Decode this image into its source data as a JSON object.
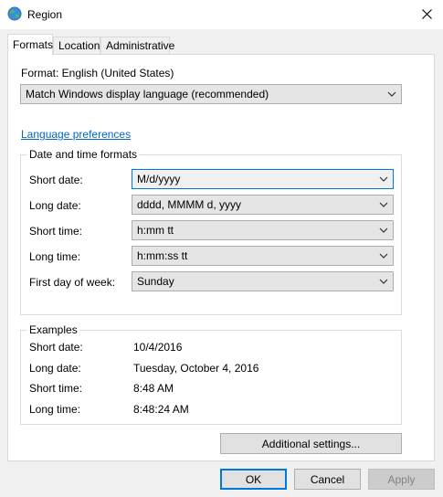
{
  "window": {
    "title": "Region",
    "close_icon": "close-icon",
    "app_icon": "globe-icon"
  },
  "tabs": [
    {
      "label": "Formats",
      "active": true
    },
    {
      "label": "Location",
      "active": false
    },
    {
      "label": "Administrative",
      "active": false
    }
  ],
  "format": {
    "label": "Format: English (United States)",
    "selected": "Match Windows display language (recommended)"
  },
  "language_link": "Language preferences",
  "date_time_group": {
    "title": "Date and time formats",
    "rows": [
      {
        "label": "Short date:",
        "value": "M/d/yyyy"
      },
      {
        "label": "Long date:",
        "value": "dddd, MMMM d, yyyy"
      },
      {
        "label": "Short time:",
        "value": "h:mm tt"
      },
      {
        "label": "Long time:",
        "value": "h:mm:ss tt"
      },
      {
        "label": "First day of week:",
        "value": "Sunday"
      }
    ]
  },
  "examples_group": {
    "title": "Examples",
    "rows": [
      {
        "label": "Short date:",
        "value": "10/4/2016"
      },
      {
        "label": "Long date:",
        "value": "Tuesday, October 4, 2016"
      },
      {
        "label": "Short time:",
        "value": "8:48 AM"
      },
      {
        "label": "Long time:",
        "value": "8:48:24 AM"
      }
    ]
  },
  "buttons": {
    "additional_settings": "Additional settings...",
    "ok": "OK",
    "cancel": "Cancel",
    "apply": "Apply"
  },
  "colors": {
    "accent": "#0078d7",
    "link": "#0066cc"
  }
}
